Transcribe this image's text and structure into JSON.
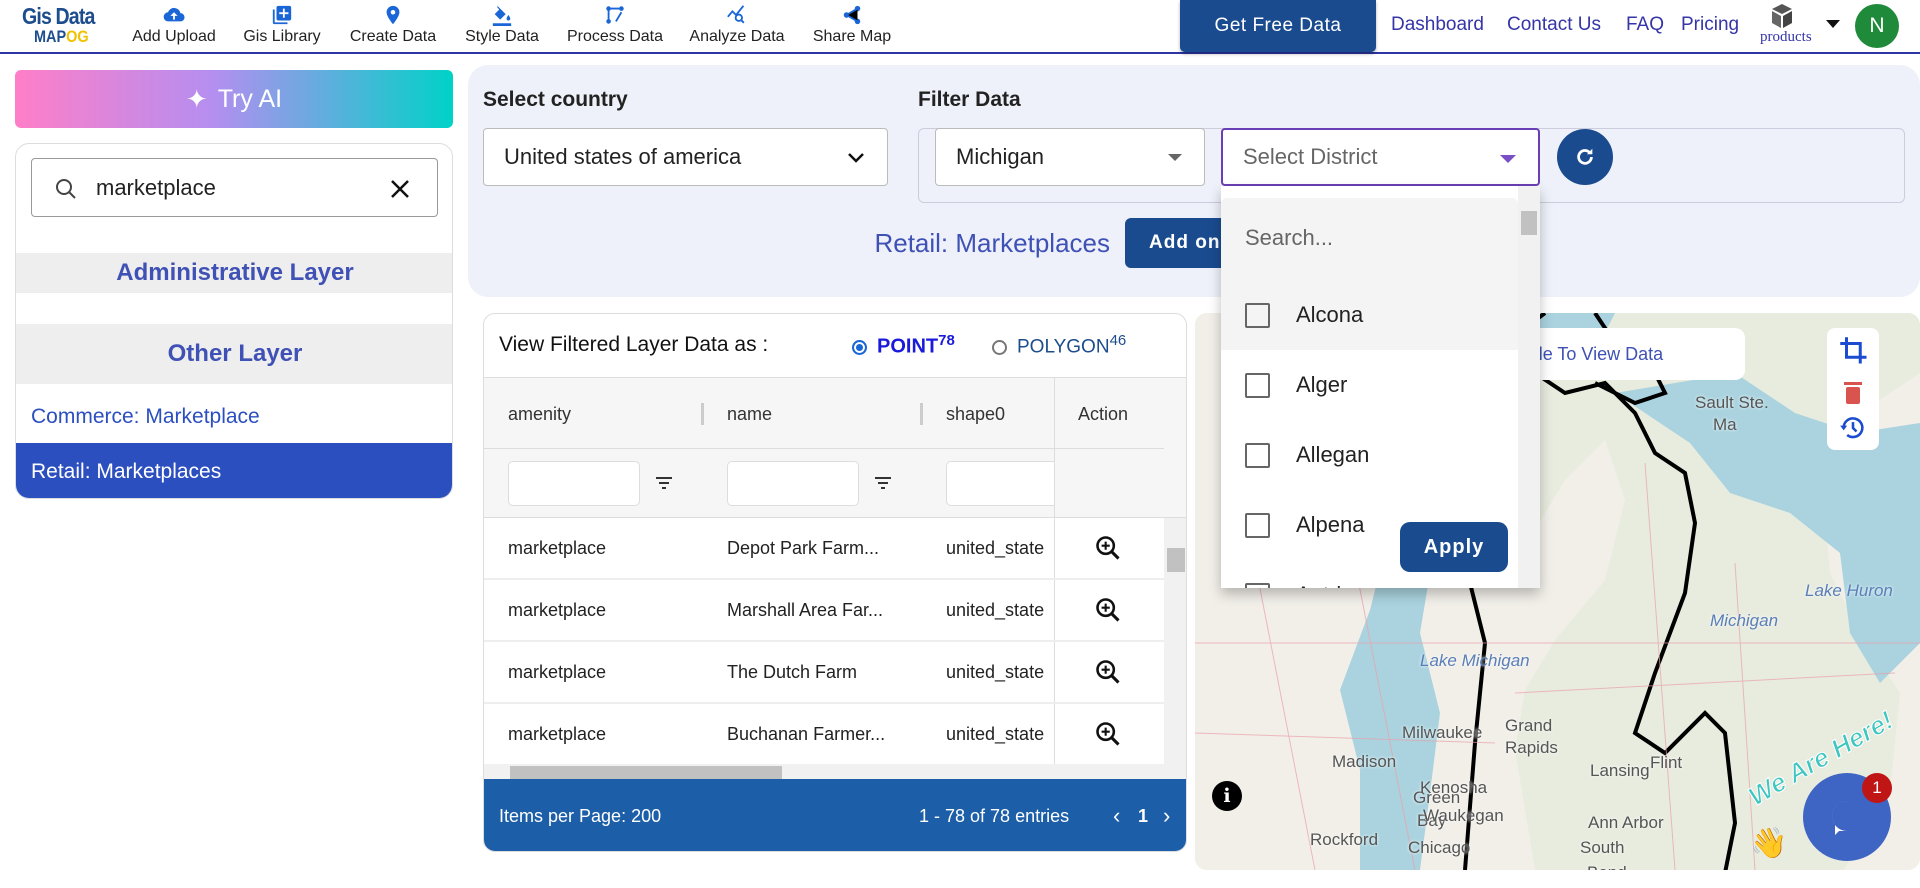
{
  "header": {
    "logo_line1": "Gis Data",
    "logo_line2a": "MAP",
    "logo_line2b": "OG",
    "nav": [
      {
        "label": "Add Upload",
        "icon": "cloud-upload-icon"
      },
      {
        "label": "Gis Library",
        "icon": "library-add-icon"
      },
      {
        "label": "Create Data",
        "icon": "map-pin-icon"
      },
      {
        "label": "Style Data",
        "icon": "paint-bucket-icon"
      },
      {
        "label": "Process Data",
        "icon": "process-icon"
      },
      {
        "label": "Analyze Data",
        "icon": "analyze-icon"
      },
      {
        "label": "Share Map",
        "icon": "share-icon"
      }
    ],
    "get_free_data": "Get Free Data",
    "links": [
      "Dashboard",
      "Contact Us",
      "FAQ",
      "Pricing"
    ],
    "products": "products",
    "avatar_initial": "N"
  },
  "sidebar": {
    "try_ai": "Try AI",
    "search_value": "marketplace",
    "admin_layer": "Administrative Layer",
    "other_layer": "Other Layer",
    "items": [
      "Commerce: Marketplace",
      "Retail: Marketplaces"
    ],
    "selected_index": 1
  },
  "filter": {
    "country_label": "Select country",
    "country_value": "United states of america",
    "filter_label": "Filter Data",
    "state_value": "Michigan",
    "district_placeholder": "Select District",
    "layer_title": "Retail: Marketplaces",
    "add_button": "Add on"
  },
  "district_dropdown": {
    "search_placeholder": "Search...",
    "options": [
      "Alcona",
      "Alger",
      "Allegan",
      "Alpena",
      "Antrim"
    ],
    "apply": "Apply"
  },
  "table": {
    "view_as_label": "View Filtered Layer Data as :",
    "point_label": "POINT",
    "point_count": "78",
    "polygon_label": "POLYGON",
    "polygon_count": "46",
    "selected_view": "POINT",
    "columns": [
      "amenity",
      "name",
      "shape0",
      "Action"
    ],
    "rows": [
      [
        "marketplace",
        "Depot Park Farm...",
        "united_state"
      ],
      [
        "marketplace",
        "Marshall Area Far...",
        "united_state"
      ],
      [
        "marketplace",
        "The Dutch Farm",
        "united_state"
      ],
      [
        "marketplace",
        "Buchanan Farmer...",
        "united_state"
      ]
    ],
    "items_per_page": "Items per Page: 200",
    "range": "1 - 78 of 78 entries",
    "page": "1"
  },
  "map": {
    "hint": "ta Table To View Data",
    "labels": [
      "Sault Ste.",
      "Ma",
      "Michigan",
      "Lake Huron",
      "Green",
      "Bay",
      "Lake Michigan",
      "Milwaukee",
      "Madison",
      "Grand",
      "Rapids",
      "Lansing",
      "Flint",
      "Kenosha",
      "Waukegan",
      "Ann Arbor",
      "Rockford",
      "Chicago",
      "South",
      "Bend"
    ],
    "chat_badge": "1",
    "we_are_here": "We Are Here!",
    "colors": {
      "water": "#aad3df",
      "land": "#f2efe9",
      "outline": "#000000"
    }
  }
}
